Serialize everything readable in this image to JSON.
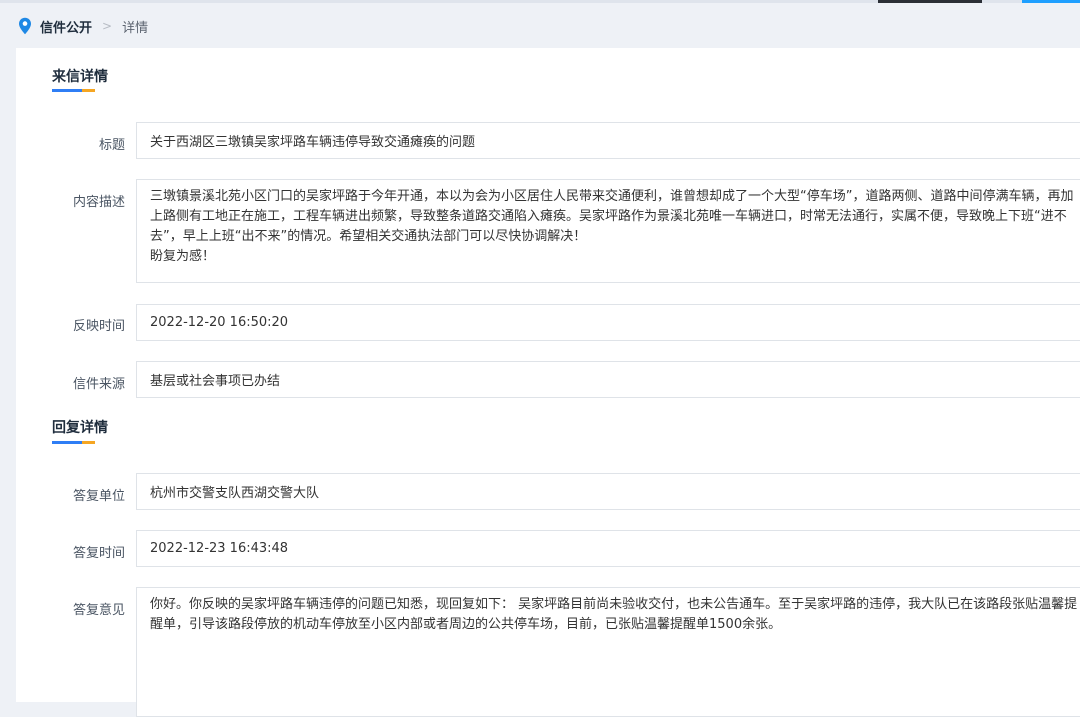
{
  "breadcrumb": {
    "home": "信件公开",
    "separator": ">",
    "current": "详情"
  },
  "letter_section": {
    "title": "来信详情"
  },
  "letter": {
    "title_label": "标题",
    "title_value": "关于西湖区三墩镇吴家坪路车辆违停导致交通瘫痪的问题",
    "content_label": "内容描述",
    "content_lines": [
      "三墩镇景溪北苑小区门口的吴家坪路于今年开通，本以为会为小区居住人民带来交通便利，谁曾想却成了一个大型“停车场”，道路两侧、道路中间停满车辆，再加",
      "上路侧有工地正在施工，工程车辆进出频繁，导致整条道路交通陷入瘫痪。吴家坪路作为景溪北苑唯一车辆进口，时常无法通行，实属不便，导致晚上下班“进不",
      "去”，早上上班“出不来”的情况。希望相关交通执法部门可以尽快协调解决！",
      "盼复为感！"
    ],
    "time_label": "反映时间",
    "time_value": "2022-12-20 16:50:20",
    "source_label": "信件来源",
    "source_value": "基层或社会事项已办结"
  },
  "reply_section": {
    "title": "回复详情"
  },
  "reply": {
    "unit_label": "答复单位",
    "unit_value": "杭州市交警支队西湖交警大队",
    "time_label": "答复时间",
    "time_value": "2022-12-23 16:43:48",
    "opinion_label": "答复意见",
    "opinion_lines": [
      "你好。你反映的吴家坪路车辆违停的问题已知悉，现回复如下： 吴家坪路目前尚未验收交付，也未公告通车。至于吴家坪路的违停，我大队已在该路段张贴温馨提",
      "醒单，引导该路段停放的机动车停放至小区内部或者周边的公共停车场，目前，已张贴温馨提醒单1500余张。"
    ]
  },
  "icons": {
    "breadcrumb_pin": "location-pin-icon"
  },
  "colors": {
    "accent_blue": "#2f7ef5",
    "accent_orange": "#f5a623",
    "pin_blue": "#1e88e5"
  }
}
